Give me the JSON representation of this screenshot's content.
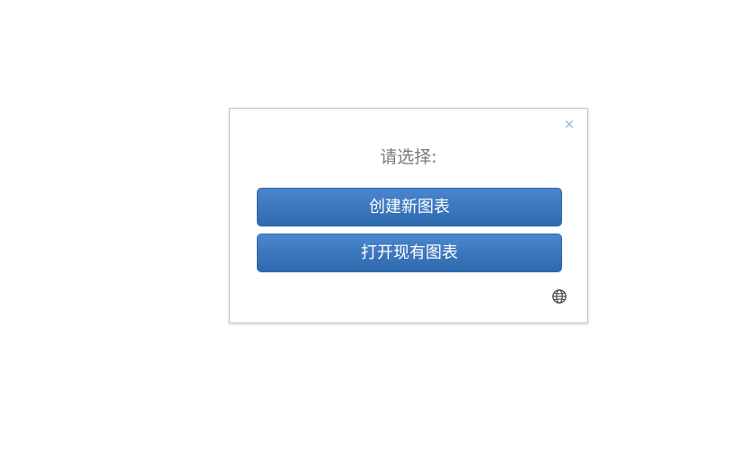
{
  "dialog": {
    "title": "请选择:",
    "close_icon": "close-icon",
    "language_icon": "globe-icon",
    "buttons": {
      "create_label": "创建新图表",
      "open_label": "打开现有图表"
    },
    "colors": {
      "button_top": "#4a86cf",
      "button_bottom": "#2f69ad",
      "title_text": "#7a7a7a",
      "close_icon": "#8fb2d6"
    }
  }
}
